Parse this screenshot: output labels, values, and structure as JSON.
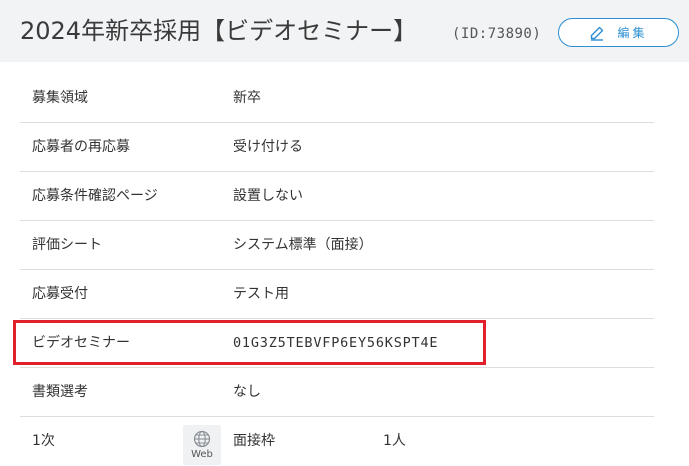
{
  "header": {
    "title": "2024年新卒採用【ビデオセミナー】",
    "id_text": "(ID:73890)",
    "edit_label": "編集"
  },
  "rows": [
    {
      "label": "募集領域",
      "value": "新卒"
    },
    {
      "label": "応募者の再応募",
      "value": "受け付ける"
    },
    {
      "label": "応募条件確認ページ",
      "value": "設置しない"
    },
    {
      "label": "評価シート",
      "value": "システム標準（面接）"
    },
    {
      "label": "応募受付",
      "value": "テスト用"
    },
    {
      "label": "ビデオセミナー",
      "value": "01G3Z5TEBVFP6EY56KSPT4E"
    },
    {
      "label": "書類選考",
      "value": "なし"
    }
  ],
  "stage": {
    "label": "1次",
    "badge": "Web",
    "slot_label": "面接枠",
    "slot_value": "1人"
  },
  "colors": {
    "accent": "#2c8fd3",
    "highlight": "#e0202a",
    "header_bg": "#f2f3f5"
  },
  "icons": {
    "edit": "pencil-icon",
    "web": "globe-icon"
  }
}
